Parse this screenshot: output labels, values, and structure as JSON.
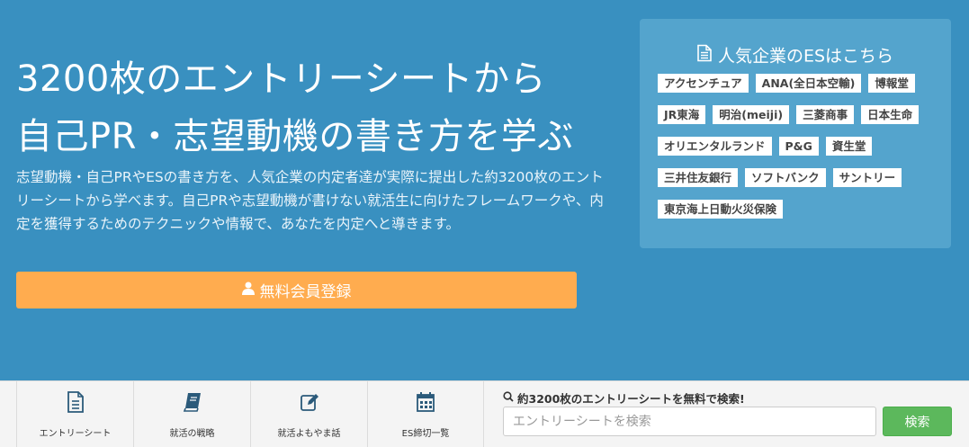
{
  "hero": {
    "headline_line1": "3200枚のエントリーシートから",
    "headline_line2": "自己PR・志望動機の書き方を学ぶ",
    "description": "志望動機・自己PRやESの書き方を、人気企業の内定者達が実際に提出した約3200枚のエントリーシートから学べます。自己PRや志望動機が書けない就活生に向けたフレームワークや、内定を獲得するためのテクニックや情報で、あなたを内定へと導きます。",
    "cta_label": "無料会員登録",
    "cta_icon": "user-icon"
  },
  "es_panel": {
    "title": "人気企業のESはこちら",
    "title_icon": "document-icon",
    "tags": [
      "アクセンチュア",
      "ANA(全日本空輸)",
      "博報堂",
      "JR東海",
      "明治(meiji)",
      "三菱商事",
      "日本生命",
      "オリエンタルランド",
      "P&G",
      "資生堂",
      "三井住友銀行",
      "ソフトバンク",
      "サントリー",
      "東京海上日動火災保険"
    ]
  },
  "nav": {
    "items": [
      {
        "label": "エントリーシート",
        "icon": "document-icon"
      },
      {
        "label": "就活の戦略",
        "icon": "book-icon"
      },
      {
        "label": "就活よもやま話",
        "icon": "edit-icon"
      },
      {
        "label": "ES締切一覧",
        "icon": "calendar-icon"
      }
    ]
  },
  "search": {
    "heading": "約3200枚のエントリーシートを無料で検索!",
    "placeholder": "エントリーシートを検索",
    "value": "",
    "button_label": "検索"
  },
  "colors": {
    "hero_bg": "#3990c0",
    "panel_bg": "#54a4cd",
    "cta": "#ffac4f",
    "search_button": "#5cb85c"
  }
}
